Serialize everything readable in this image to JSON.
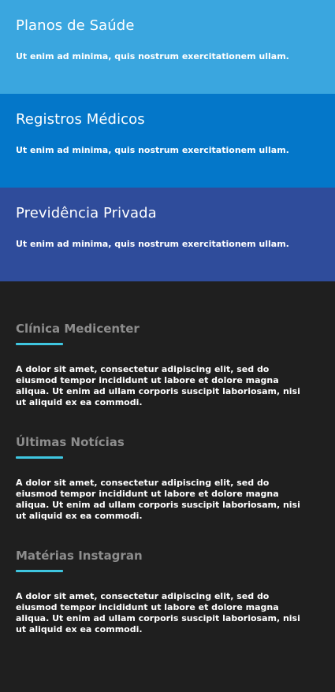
{
  "cards": [
    {
      "title": "Planos de Saúde",
      "text": "Ut enim ad minima, quis nostrum exercitationem ullam.",
      "color": "#3aa6df"
    },
    {
      "title": "Registros Médicos",
      "text": "Ut enim ad minima, quis nostrum exercitationem ullam.",
      "color": "#0477c9"
    },
    {
      "title": "Previdência Privada",
      "text": "Ut enim ad minima, quis nostrum exercitationem ullam.",
      "color": "#2f4c9b"
    }
  ],
  "footer": {
    "sections": [
      {
        "title": "Clínica Medicenter",
        "text": "A dolor sit amet, consectetur adipiscing elit, sed do eiusmod tempor incididunt ut labore et dolore magna aliqua. Ut enim ad ullam corporis suscipit laboriosam, nisi ut aliquid ex ea commodi."
      },
      {
        "title": "Últimas Notícias",
        "text": "A dolor sit amet, consectetur adipiscing elit, sed do eiusmod tempor incididunt ut labore et dolore magna aliqua. Ut enim ad ullam corporis suscipit laboriosam, nisi ut aliquid ex ea commodi."
      },
      {
        "title": "Matérias Instagran",
        "text": "A dolor sit amet, consectetur adipiscing elit, sed do eiusmod tempor incididunt ut labore et dolore magna aliqua. Ut enim ad ullam corporis suscipit laboriosam, nisi ut aliquid ex ea commodi."
      }
    ],
    "accent_color": "#3fc6e0",
    "background": "#1f1f1f"
  }
}
